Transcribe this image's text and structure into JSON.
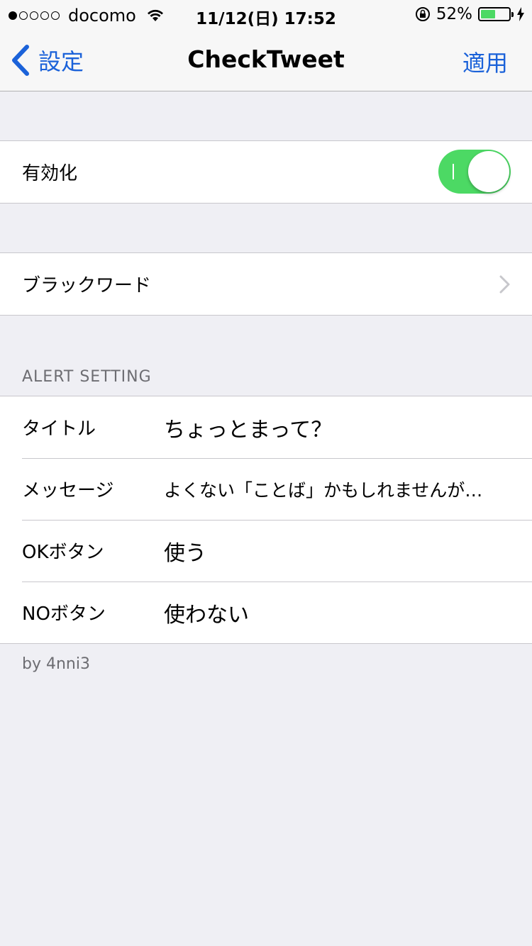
{
  "status_bar": {
    "carrier": "docomo",
    "time": "11/12(日) 17:52",
    "battery": "52%",
    "battery_level": 0.52
  },
  "nav": {
    "back_label": "設定",
    "title": "CheckTweet",
    "apply_label": "適用"
  },
  "enable": {
    "label": "有効化",
    "on": true
  },
  "blackword": {
    "label": "ブラックワード"
  },
  "alert": {
    "header": "ALERT SETTING",
    "rows": [
      {
        "label": "タイトル",
        "value": "ちょっとまって？"
      },
      {
        "label": "メッセージ",
        "value": "よくない「ことば」かもしれませんが…"
      },
      {
        "label": "OKボタン",
        "value": "使う"
      },
      {
        "label": "NOボタン",
        "value": "使わない"
      }
    ]
  },
  "footer": {
    "text": "by 4nni3"
  },
  "colors": {
    "accent": "#1b62d9",
    "toggle_on": "#4cd964",
    "background": "#efeff4"
  }
}
